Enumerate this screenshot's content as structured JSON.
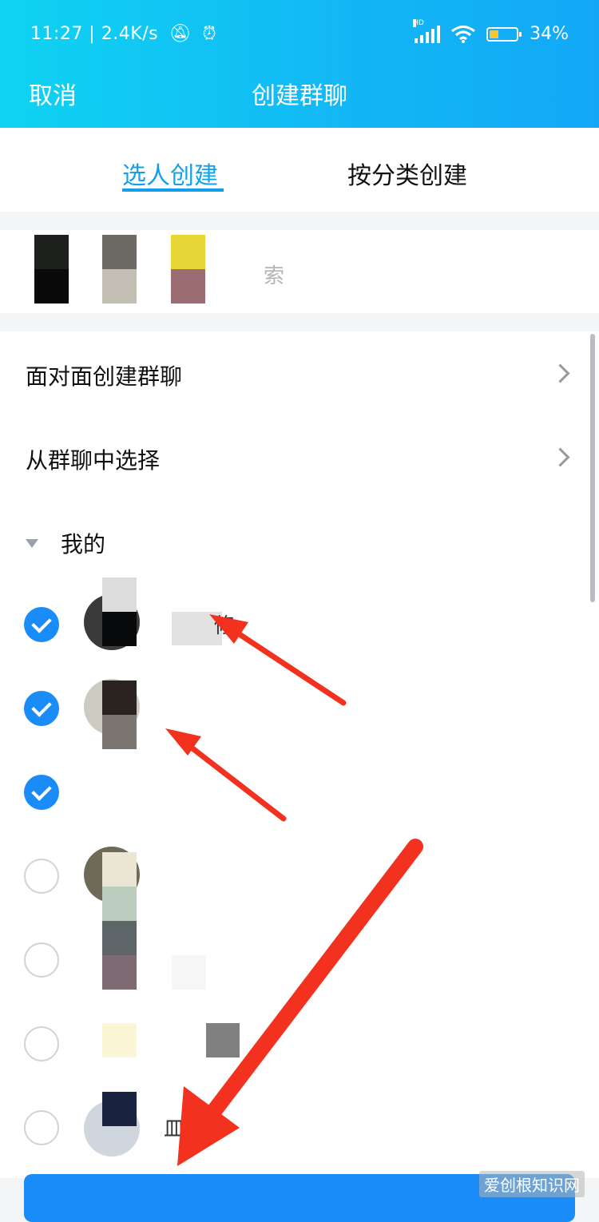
{
  "status_bar": {
    "time_speed": "11:27 | 2.4K/s",
    "network_label": "HD",
    "battery": "34%",
    "battery_level": 0.34
  },
  "header": {
    "cancel": "取消",
    "title": "创建群聊"
  },
  "tabs": [
    {
      "label": "选人创建",
      "active": true
    },
    {
      "label": "按分类创建",
      "active": false
    }
  ],
  "search": {
    "placeholder_fragment": "索"
  },
  "options": [
    {
      "label": "面对面创建群聊"
    },
    {
      "label": "从群聊中选择"
    }
  ],
  "group": {
    "label_fragment": "我的"
  },
  "contacts": [
    {
      "selected": true,
      "name_fragment": "修"
    },
    {
      "selected": true,
      "name_fragment": ""
    },
    {
      "selected": true,
      "name_fragment": ""
    },
    {
      "selected": false,
      "name_fragment": ""
    },
    {
      "selected": false,
      "name_fragment": ""
    },
    {
      "selected": false,
      "name_fragment": ""
    },
    {
      "selected": false,
      "name_fragment": "皿"
    }
  ],
  "watermark": "爱创根知识网",
  "colors": {
    "accent": "#1a8cf7",
    "tab_active": "#12a0ee",
    "arrow": "#f2311f"
  }
}
